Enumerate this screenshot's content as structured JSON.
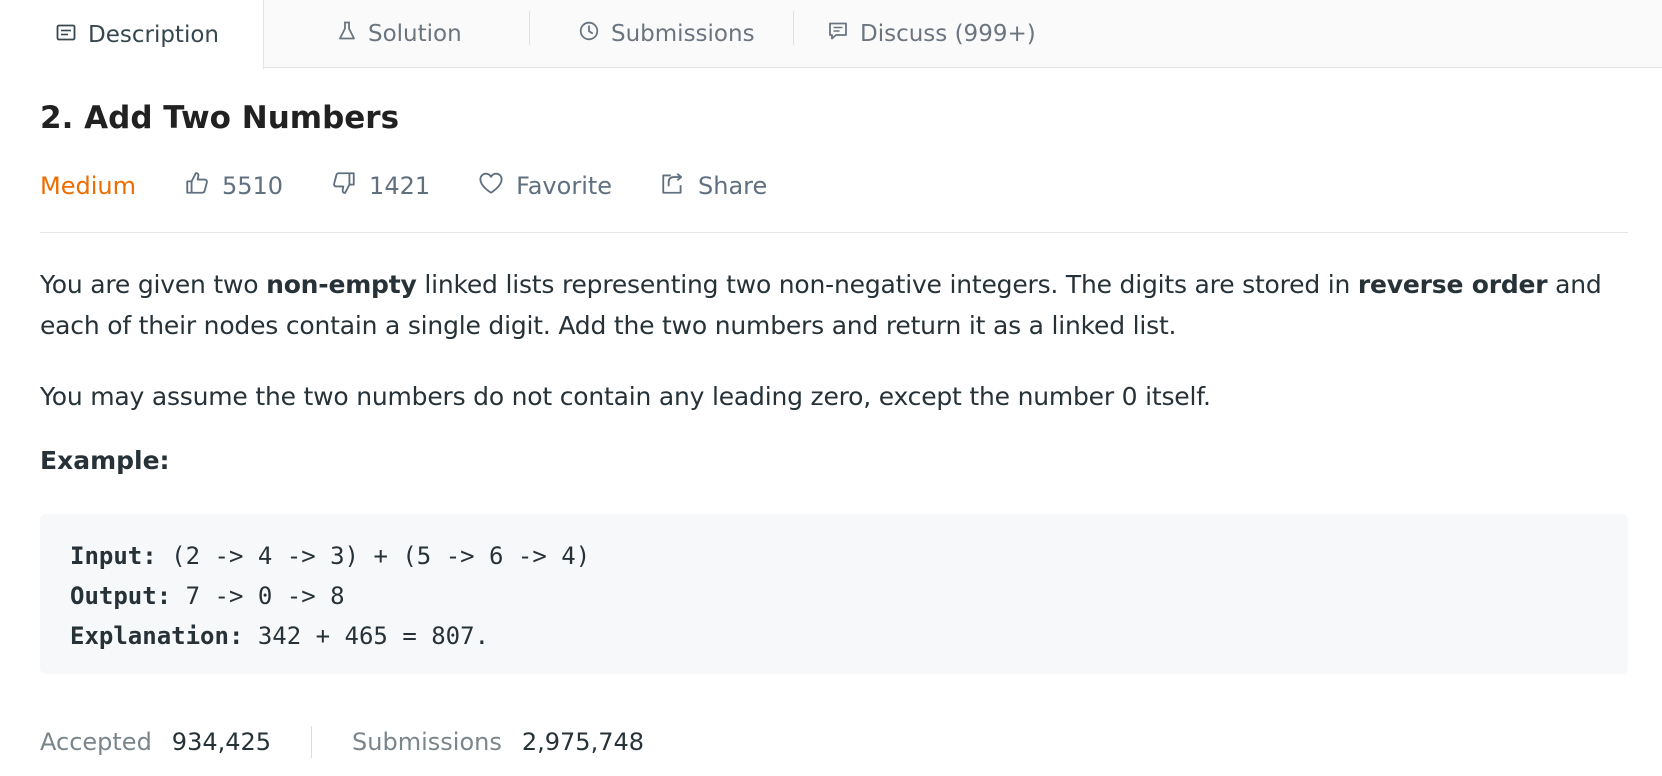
{
  "tabs": [
    {
      "label": "Description",
      "icon": "description-icon",
      "active": true
    },
    {
      "label": "Solution",
      "icon": "flask-icon",
      "active": false
    },
    {
      "label": "Submissions",
      "icon": "clock-icon",
      "active": false
    },
    {
      "label": "Discuss (999+)",
      "icon": "comment-icon",
      "active": false
    }
  ],
  "problem": {
    "title": "2. Add Two Numbers",
    "difficulty": "Medium",
    "likes": "5510",
    "dislikes": "1421",
    "favorite_label": "Favorite",
    "share_label": "Share"
  },
  "description": {
    "p1_a": "You are given two ",
    "p1_b": "non-empty",
    "p1_c": " linked lists representing two non-negative integers. The digits are stored in ",
    "p1_d": "reverse order",
    "p1_e": " and each of their nodes contain a single digit. Add the two numbers and return it as a linked list.",
    "p2": "You may assume the two numbers do not contain any leading zero, except the number 0 itself.",
    "example_label": "Example:"
  },
  "example": {
    "input_label": "Input:",
    "input_value": " (2 -> 4 -> 3) + (5 -> 6 -> 4)",
    "output_label": "Output:",
    "output_value": " 7 -> 0 -> 8",
    "explanation_label": "Explanation:",
    "explanation_value": " 342 + 465 = 807."
  },
  "stats": {
    "accepted_label": "Accepted",
    "accepted_value": "934,425",
    "submissions_label": "Submissions",
    "submissions_value": "2,975,748"
  },
  "colors": {
    "difficulty_medium": "#ef6c00",
    "tab_bar_bg": "#fafafa",
    "code_bg": "#f7f8fa"
  }
}
